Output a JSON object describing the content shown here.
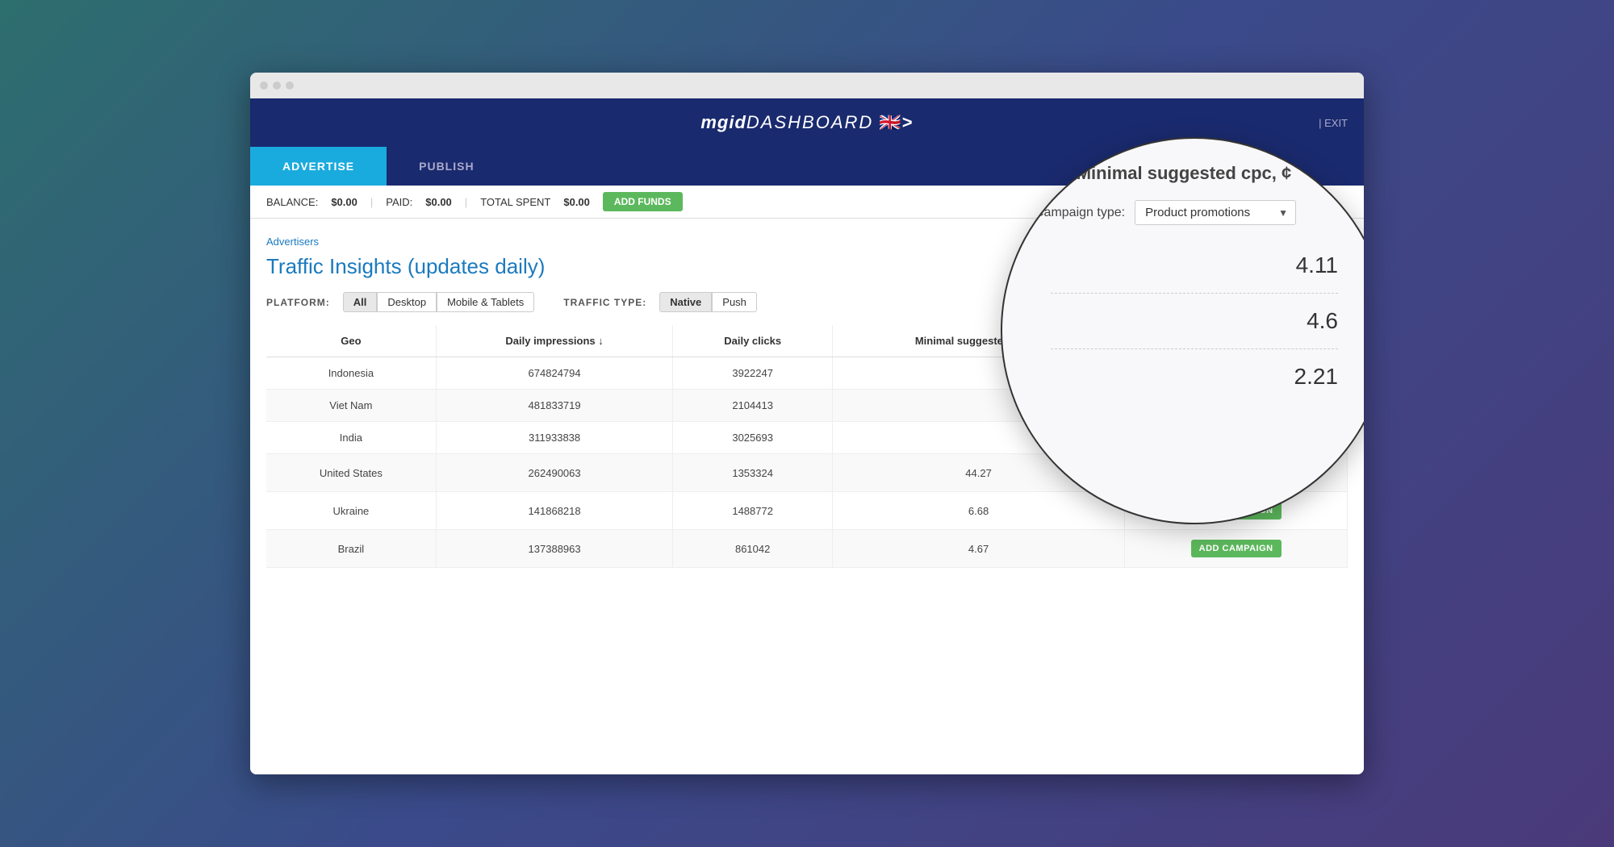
{
  "browser": {
    "titlebar_dots": [
      "dot1",
      "dot2",
      "dot3"
    ]
  },
  "header": {
    "logo": "mgid",
    "logo_suffix": "DASHBOARD",
    "flag": "🇬🇧",
    "header_links": "| EXIT"
  },
  "subnav": {
    "tabs": [
      {
        "label": "ADVERTISE",
        "active": true
      },
      {
        "label": "PUBLISH",
        "active": false
      }
    ]
  },
  "balance_bar": {
    "balance_label": "BALANCE:",
    "balance_value": "$0.00",
    "paid_label": "PAID:",
    "paid_value": "$0.00",
    "total_spent_label": "TOTAL SPENT",
    "total_spent_value": "$0.00",
    "add_funds_label": "ADD FUNDS"
  },
  "breadcrumb": {
    "text": "Advertisers",
    "href": "#"
  },
  "page_title": "Traffic Insights (updates daily)",
  "filters": {
    "platform_label": "PLATFORM:",
    "platform_buttons": [
      {
        "label": "All",
        "active": true
      },
      {
        "label": "Desktop",
        "active": false
      },
      {
        "label": "Mobile & Tablets",
        "active": false
      }
    ],
    "traffic_label": "TRAFFIC TYPE:",
    "traffic_buttons": [
      {
        "label": "Native",
        "active": true
      },
      {
        "label": "Push",
        "active": false
      }
    ]
  },
  "table": {
    "columns": [
      "Geo",
      "Daily impressions ↓",
      "Daily clicks",
      "Minimal suggested cpc, ¢",
      ""
    ],
    "rows": [
      {
        "geo": "Indonesia",
        "daily_impressions": "674824794",
        "daily_clicks": "3922247",
        "min_cpc": "",
        "action": ""
      },
      {
        "geo": "Viet Nam",
        "daily_impressions": "481833719",
        "daily_clicks": "2104413",
        "min_cpc": "",
        "action": ""
      },
      {
        "geo": "India",
        "daily_impressions": "311933838",
        "daily_clicks": "3025693",
        "min_cpc": "",
        "action": ""
      },
      {
        "geo": "United States",
        "daily_impressions": "262490063",
        "daily_clicks": "1353324",
        "min_cpc": "44.27",
        "action": "ADD CAMPAIGN"
      },
      {
        "geo": "Ukraine",
        "daily_impressions": "141868218",
        "daily_clicks": "1488772",
        "min_cpc": "6.68",
        "action": "ADD CAMPAIGN"
      },
      {
        "geo": "Brazil",
        "daily_impressions": "137388963",
        "daily_clicks": "861042",
        "min_cpc": "4.67",
        "action": "ADD CAMPAIGN"
      }
    ]
  },
  "magnified": {
    "title": "Minimal suggested cpc, ¢",
    "campaign_type_label": "Campaign type:",
    "selected_option": "Product promotions",
    "dropdown_arrow": "▼",
    "cpc_values": [
      "4.11",
      "4.6",
      "2.21"
    ],
    "info_icon": "i"
  },
  "decoration": {
    "star": "✳"
  }
}
